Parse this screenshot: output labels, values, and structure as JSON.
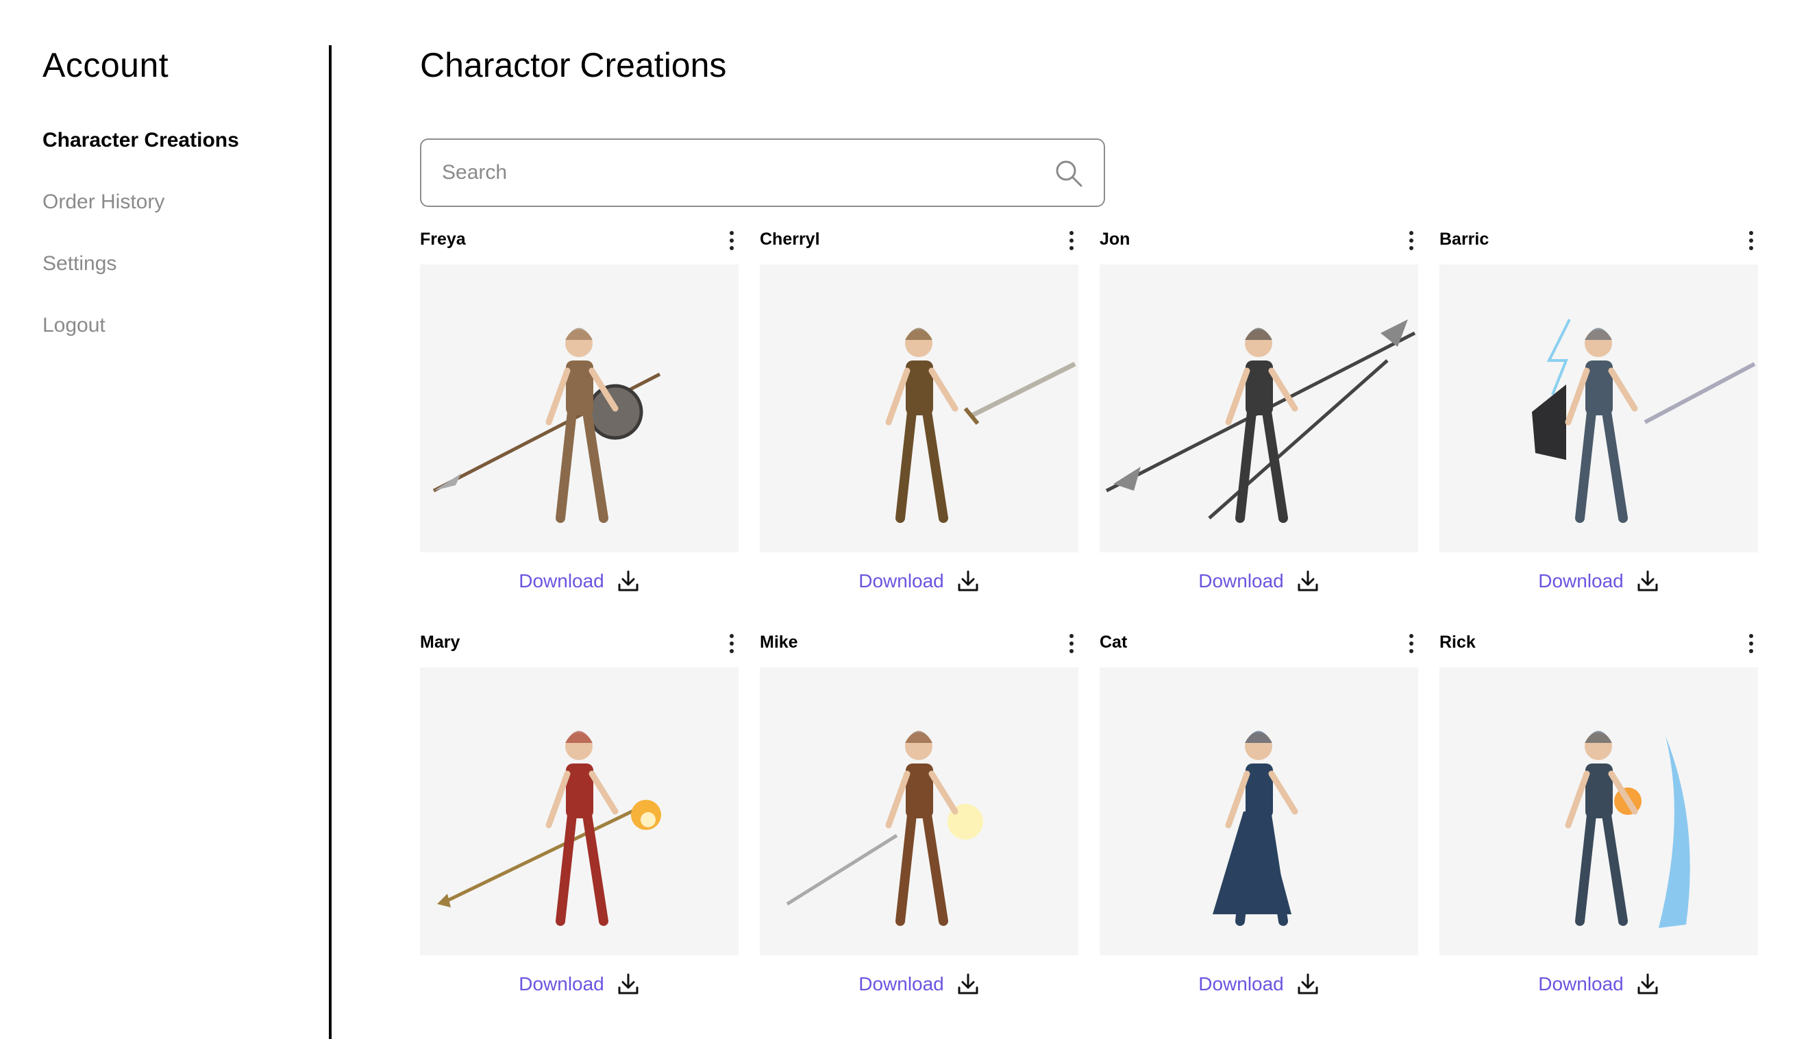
{
  "sidebar": {
    "title": "Account",
    "items": [
      {
        "label": "Character Creations",
        "active": true
      },
      {
        "label": "Order History",
        "active": false
      },
      {
        "label": "Settings",
        "active": false
      },
      {
        "label": "Logout",
        "active": false
      }
    ]
  },
  "main": {
    "title": "Charactor Creations",
    "search": {
      "placeholder": "Search",
      "value": "",
      "icon": "search-icon"
    },
    "download_label": "Download",
    "cards": [
      {
        "name": "Freya",
        "weapon": "spear",
        "accent": "#8a6a4a"
      },
      {
        "name": "Cherryl",
        "weapon": "sword",
        "accent": "#6b4f2a"
      },
      {
        "name": "Jon",
        "weapon": "halberd",
        "accent": "#3a3a3a"
      },
      {
        "name": "Barric",
        "weapon": "sword-lightning",
        "accent": "#4a5a6a"
      },
      {
        "name": "Mary",
        "weapon": "staff-fire",
        "accent": "#a03028"
      },
      {
        "name": "Mike",
        "weapon": "sword-light",
        "accent": "#7a4a2a"
      },
      {
        "name": "Cat",
        "weapon": "none",
        "accent": "#2a4260"
      },
      {
        "name": "Rick",
        "weapon": "ice-fire",
        "accent": "#3a4a5a"
      }
    ]
  },
  "colors": {
    "link": "#6a55e0",
    "thumb_bg": "#f5f5f5",
    "muted_text": "#8a8a8a"
  }
}
